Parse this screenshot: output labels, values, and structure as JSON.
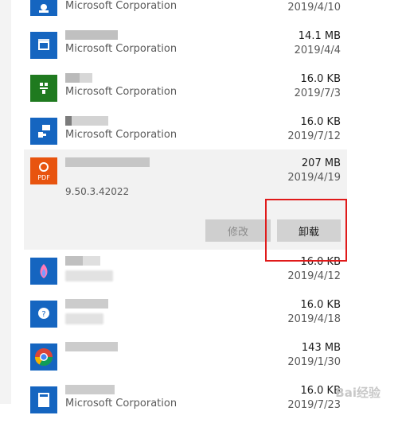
{
  "rows": [
    {
      "publisher": "Microsoft Corporation",
      "size": "",
      "date": "2019/4/10",
      "icon": "people-icon",
      "color": "#1565c0"
    },
    {
      "publisher": "Microsoft Corporation",
      "size": "14.1 MB",
      "date": "2019/4/4",
      "icon": "movies-tv-icon",
      "color": "#1565c0"
    },
    {
      "publisher": "Microsoft Corporation",
      "size": "16.0 KB",
      "date": "2019/7/3",
      "icon": "xbox-icon",
      "color": "#1f7a1f"
    },
    {
      "publisher": "Microsoft Corporation",
      "size": "16.0 KB",
      "date": "2019/7/12",
      "icon": "feedback-icon",
      "color": "#1565c0"
    }
  ],
  "selected": {
    "size": "207 MB",
    "date": "2019/4/19",
    "version": "9.50.3.42022",
    "icon": "pdf-icon",
    "icon_label": "PDF",
    "color": "#e8540f",
    "modify_label": "修改",
    "uninstall_label": "卸载"
  },
  "rows_after": [
    {
      "size": "16.0 KB",
      "date": "2019/4/12",
      "icon": "paint-3d-icon",
      "color": "#1565c0"
    },
    {
      "size": "16.0 KB",
      "date": "2019/4/18",
      "icon": "get-help-icon",
      "color": "#1565c0"
    },
    {
      "size": "143 MB",
      "date": "2019/1/30",
      "icon": "chrome-icon",
      "color": "#1565c0"
    },
    {
      "publisher": "Microsoft Corporation",
      "size": "16.0 KB",
      "date": "2019/7/23",
      "icon": "calculator-icon",
      "color": "#1565c0"
    }
  ],
  "watermark": "Bai经验"
}
